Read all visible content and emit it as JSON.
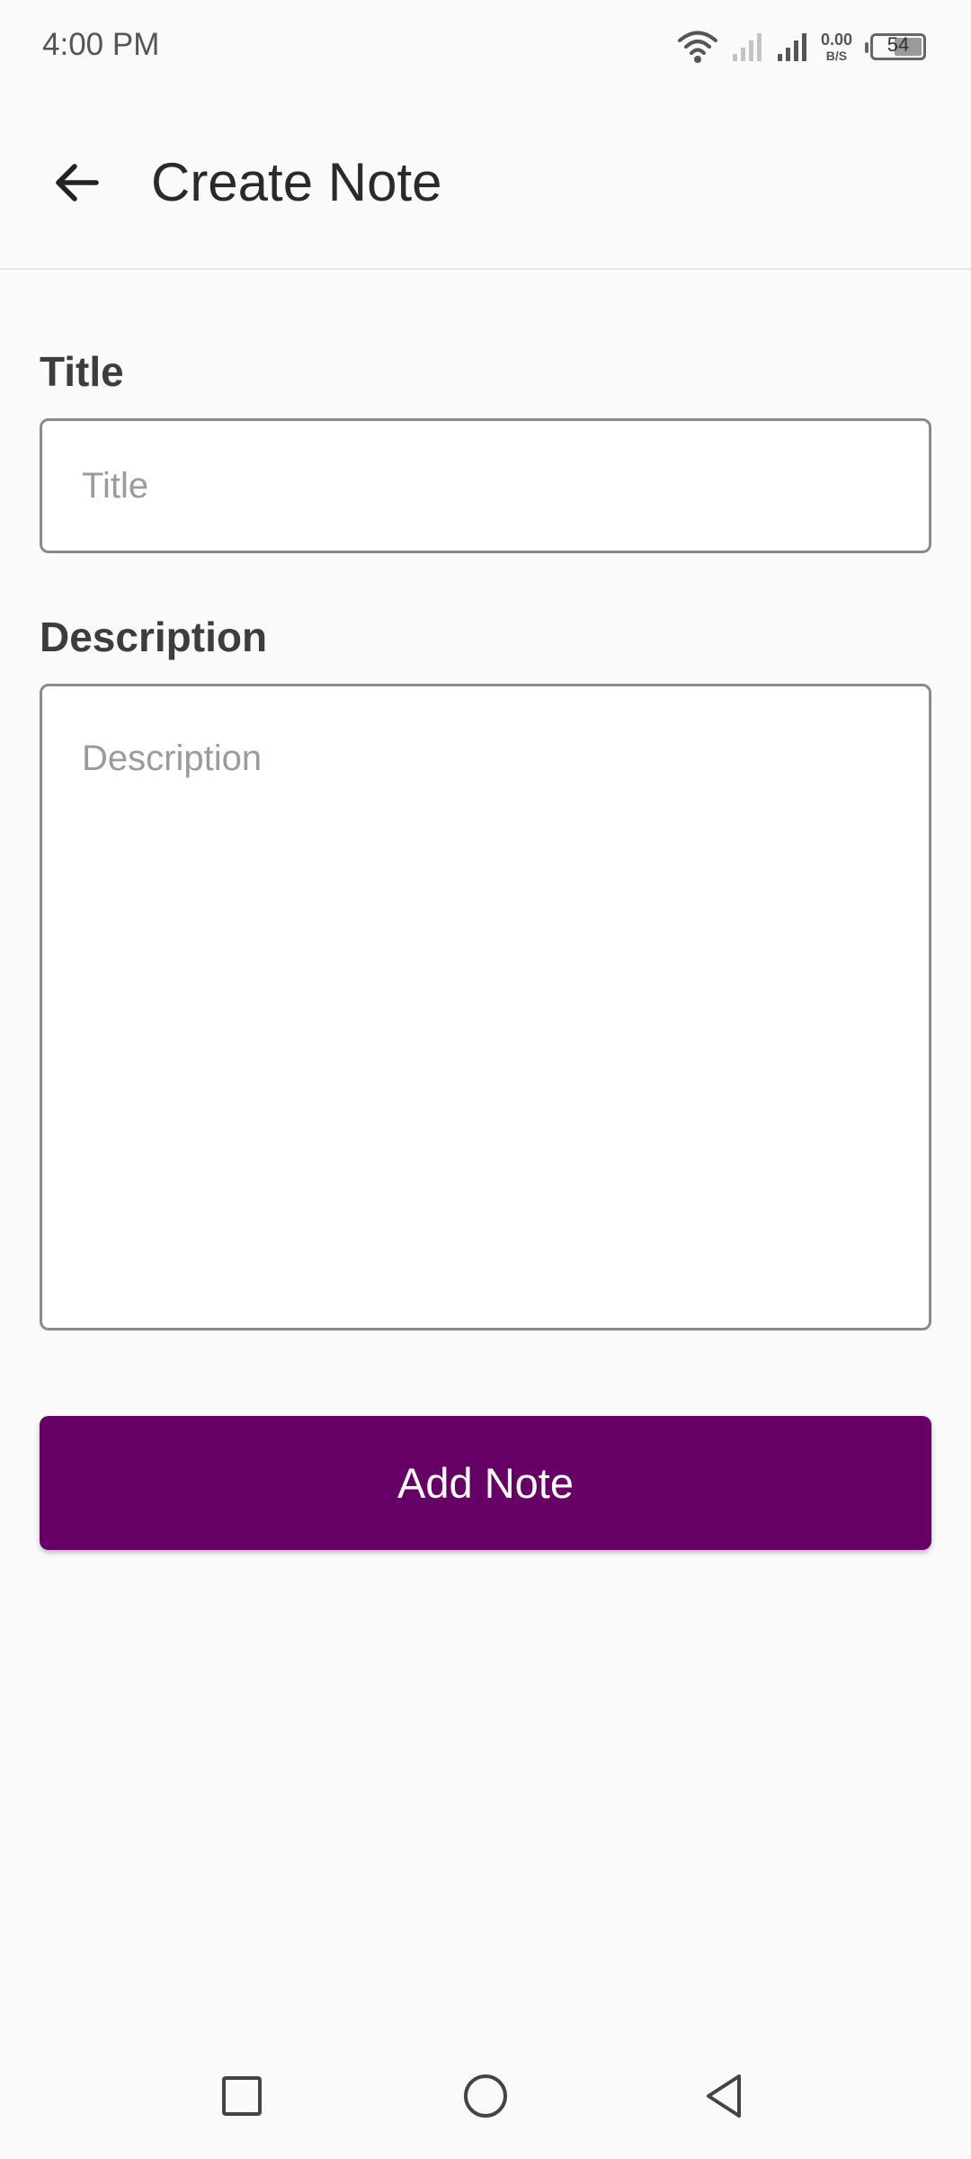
{
  "status_bar": {
    "time": "4:00 PM",
    "net_speed_value": "0.00",
    "net_speed_unit": "B/S",
    "battery_level": "54",
    "battery_fraction": 0.54
  },
  "app_bar": {
    "title": "Create Note",
    "back_icon": "arrow-back-icon"
  },
  "form": {
    "title_label": "Title",
    "title_placeholder": "Title",
    "title_value": "",
    "description_label": "Description",
    "description_placeholder": "Description",
    "description_value": "",
    "submit_label": "Add Note"
  },
  "nav_bar": {
    "icons": [
      "recents-square-icon",
      "home-circle-icon",
      "back-triangle-icon"
    ]
  },
  "colors": {
    "accent": "#660066",
    "background": "#fafafa",
    "input_border": "#8a8a8a"
  }
}
